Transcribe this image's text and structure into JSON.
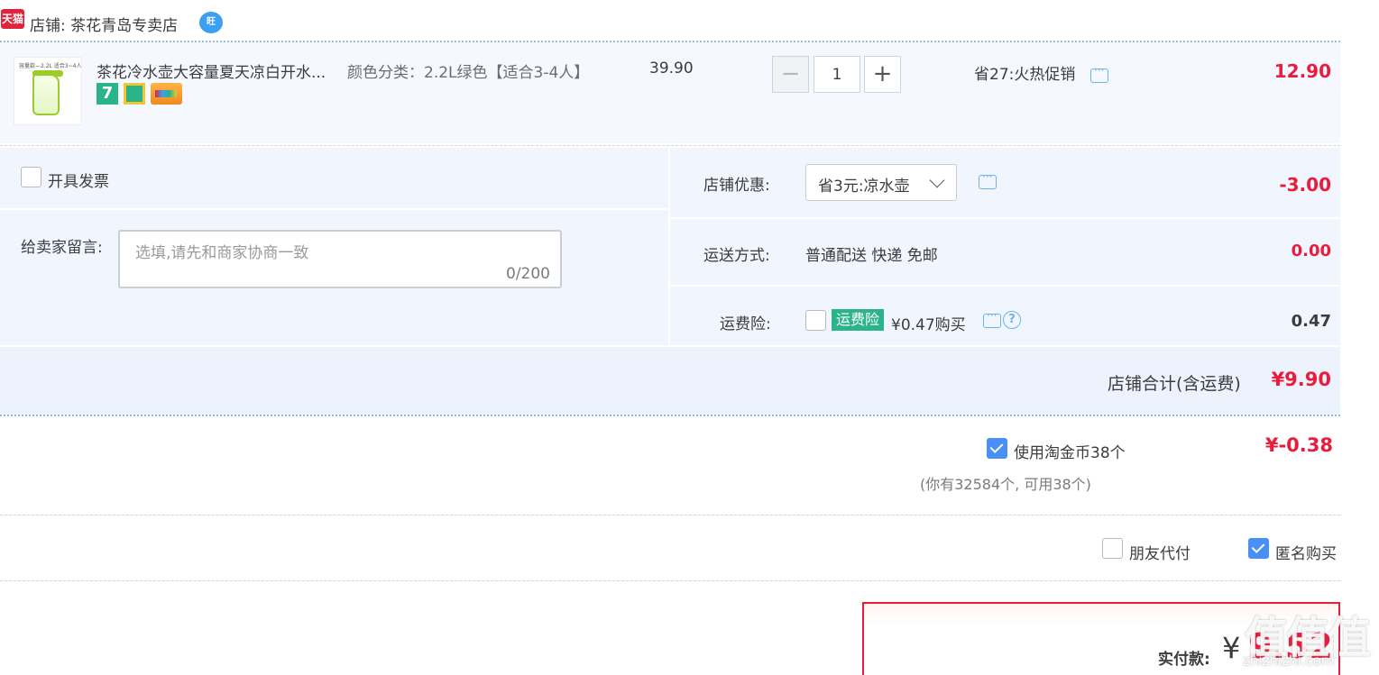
{
  "shop": {
    "badge": "天猫",
    "name": "店铺: 茶花青岛专卖店",
    "wangwang": "旺"
  },
  "item": {
    "thumbnail_text": "容量款—2.2L 适合3~4人",
    "title": "茶花冷水壶大容量夏天凉白开水...",
    "service_badge_7": "7",
    "sku": "颜色分类：2.2L绿色【适合3-4人】",
    "unit_price": "39.90",
    "quantity": "1",
    "minus": "−",
    "plus": "+",
    "promo": "省27:火热促销",
    "total": "12.90"
  },
  "options": {
    "invoice_label": "开具发票",
    "message_label": "给卖家留言:",
    "message_placeholder": "选填,请先和商家协商一致",
    "message_count": "0/200",
    "coupon_label": "店铺优惠:",
    "coupon_value": "省3元:凉水壶",
    "coupon_amount": "-3.00",
    "shipping_label": "运送方式:",
    "shipping_value": "普通配送 快递 免邮",
    "shipping_amount": "0.00",
    "insurance_label": "运费险:",
    "insurance_badge": "运费险",
    "insurance_price": "¥0.47购买",
    "insurance_help": "?",
    "insurance_amount": "0.47"
  },
  "shop_total": {
    "label": "店铺合计(含运费)",
    "value": "¥9.90"
  },
  "coins": {
    "label": "使用淘金币38个",
    "amount": "¥-0.38",
    "note": "(你有32584个, 可用38个)",
    "checked": true
  },
  "pay_options": {
    "friend_pay": "朋友代付",
    "anonymous": "匿名购买",
    "anonymous_checked": true
  },
  "payment": {
    "label": "实付款:",
    "currency": "¥",
    "amount": "9.52"
  },
  "watermark": {
    "mark": "值值值",
    "text": "zhizhizhi.com"
  },
  "colors": {
    "accent_red": "#ea1c3c",
    "checkbox_blue": "#4a8ff5",
    "service_green": "#2bb38a",
    "panel_bg": "#f0f5fe"
  }
}
